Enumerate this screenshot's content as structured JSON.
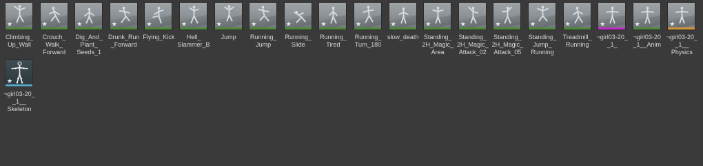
{
  "assets": [
    {
      "label": "Climbing_\nUp_Wall",
      "bar_color": "#4e8a3a",
      "icon": "animation-icon"
    },
    {
      "label": "Crouch_\nWalk_\nForward",
      "bar_color": "#4e8a3a",
      "icon": "animation-icon"
    },
    {
      "label": "Dig_And_\nPlant_\nSeeds_1",
      "bar_color": "#4e8a3a",
      "icon": "animation-icon"
    },
    {
      "label": "Drunk_Run\n_Forward",
      "bar_color": "#4e8a3a",
      "icon": "animation-icon"
    },
    {
      "label": "Flying_Kick",
      "bar_color": "#4e8a3a",
      "icon": "animation-icon"
    },
    {
      "label": "Hell_\nSlammer_B",
      "bar_color": "#4e8a3a",
      "icon": "animation-icon"
    },
    {
      "label": "Jump",
      "bar_color": "#4e8a3a",
      "icon": "animation-icon"
    },
    {
      "label": "Running_\nJump",
      "bar_color": "#4e8a3a",
      "icon": "animation-icon"
    },
    {
      "label": "Running_\nSlide",
      "bar_color": "#4e8a3a",
      "icon": "animation-icon"
    },
    {
      "label": "Running_\nTired",
      "bar_color": "#4e8a3a",
      "icon": "animation-icon"
    },
    {
      "label": "Running_\nTurn_180",
      "bar_color": "#4e8a3a",
      "icon": "animation-icon"
    },
    {
      "label": "slow_death",
      "bar_color": "#4e8a3a",
      "icon": "animation-icon"
    },
    {
      "label": "Standing_\n2H_Magic_\nArea",
      "bar_color": "#4e8a3a",
      "icon": "animation-icon"
    },
    {
      "label": "Standing_\n2H_Magic_\nAttack_02",
      "bar_color": "#4e8a3a",
      "icon": "animation-icon"
    },
    {
      "label": "Standing_\n2H_Magic_\nAttack_05",
      "bar_color": "#4e8a3a",
      "icon": "animation-icon"
    },
    {
      "label": "Standing_\nJump_\nRunning",
      "bar_color": "#4e8a3a",
      "icon": "animation-icon"
    },
    {
      "label": "Treadmill_\nRunning",
      "bar_color": "#4e8a3a",
      "icon": "animation-icon"
    },
    {
      "label": "¬girl03-20_\n_1_",
      "bar_color": "#c42ac6",
      "icon": "mesh-icon"
    },
    {
      "label": "¬girl03-20\n_1__Anim",
      "bar_color": "#4e8a3a",
      "icon": "animation-icon"
    },
    {
      "label": "¬girl03-20_\n_1__\nPhysics",
      "bar_color": "#d59637",
      "icon": "physics-asset-icon"
    },
    {
      "label": "¬girl03-20_\n_1__\nSkeleton",
      "bar_color": "#5aa6c4",
      "icon": "skeleton-icon"
    }
  ],
  "star_glyph": "★"
}
